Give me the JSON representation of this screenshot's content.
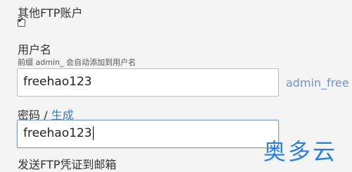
{
  "ftp_section": {
    "other_accounts_label": "其他FTP账户",
    "other_accounts_checked": true
  },
  "username": {
    "label": "用户名",
    "hint": "前缀 admin_ 会自动添加到用户名",
    "value": "freehao123",
    "prefix_preview": "admin_free"
  },
  "password": {
    "label": "密码",
    "separator": " / ",
    "generate_link": "生成",
    "value": "freehao123"
  },
  "send_email_label": "发送FTP凭证到邮箱",
  "watermark": "奥多云",
  "colors": {
    "link": "#3a78b6",
    "watermark": "#2c7fd8",
    "focus_border": "#7ea2c8"
  }
}
